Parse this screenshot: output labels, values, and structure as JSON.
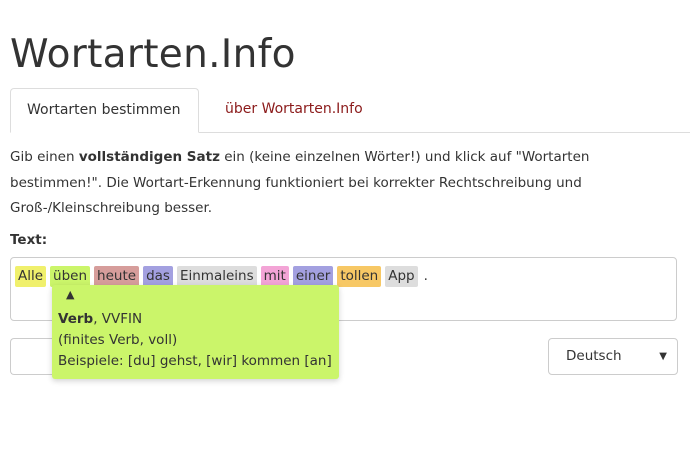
{
  "app": {
    "title": "Wortarten.Info"
  },
  "tabs": [
    {
      "label": "Wortarten bestimmen",
      "active": true
    },
    {
      "label": "über Wortarten.Info",
      "active": false
    }
  ],
  "intro": {
    "part1": "Gib einen ",
    "bold": "vollständigen Satz",
    "part2": " ein (keine einzelnen Wörter!) und klick auf \"Wortarten bestimmen!\". Die Wortart-Erkennung funktioniert bei korrekter Rechtschreibung und Groß-/Kleinschreibung besser."
  },
  "text_label": "Text:",
  "words": [
    {
      "text": "Alle",
      "color": "#f0f06c"
    },
    {
      "text": "üben",
      "color": "#cbf56a"
    },
    {
      "text": "heute",
      "color": "#d69d9b"
    },
    {
      "text": "das",
      "color": "#a3a0e0"
    },
    {
      "text": "Einmaleins",
      "color": "#dddddd"
    },
    {
      "text": "mit",
      "color": "#f3a4d6"
    },
    {
      "text": "einer",
      "color": "#a3a0e0"
    },
    {
      "text": "tollen",
      "color": "#f7c865"
    },
    {
      "text": "App",
      "color": "#dddddd"
    }
  ],
  "punctuation": ".",
  "popup": {
    "arrow": "▲",
    "pos_bold": "Verb",
    "tag": ", VVFIN",
    "description": "(finites Verb, voll)",
    "examples": "Beispiele: [du] gehst, [wir] kommen [an]",
    "color": "#cbf56a"
  },
  "language_select": {
    "value": "Deutsch",
    "caret": "▼"
  }
}
